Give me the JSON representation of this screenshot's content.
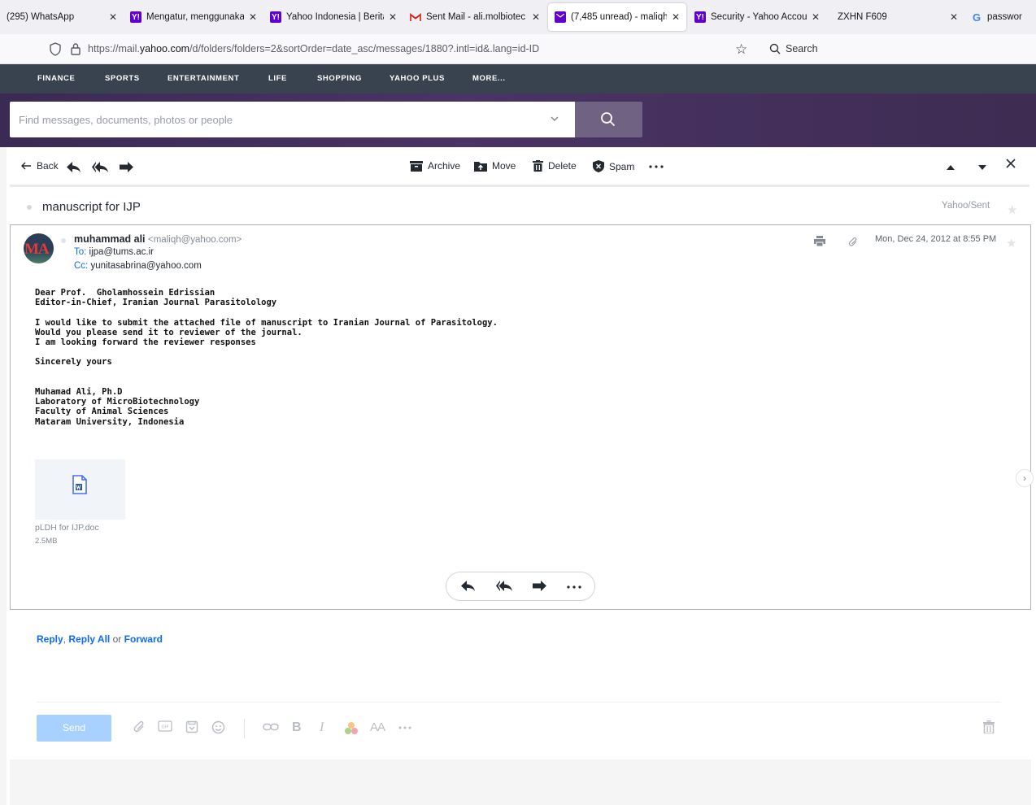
{
  "browser": {
    "tabs": [
      {
        "title": "(295) WhatsApp",
        "favicon": "none"
      },
      {
        "title": "Mengatur, menggunakan",
        "favicon": "yahoo"
      },
      {
        "title": "Yahoo Indonesia | Berita,",
        "favicon": "yahoo"
      },
      {
        "title": "Sent Mail - ali.molbiotec",
        "favicon": "gmail"
      },
      {
        "title": "(7,485 unread) - maliqh@",
        "favicon": "mail",
        "active": true
      },
      {
        "title": "Security - Yahoo Accoun",
        "favicon": "yahoo"
      },
      {
        "title": "ZXHN F609",
        "favicon": "none"
      },
      {
        "title": "passwor",
        "favicon": "google"
      }
    ],
    "url_prefix": "https://mail.",
    "url_domain": "yahoo.com",
    "url_path": "/d/folders/folders=2&sortOrder=date_asc/messages/1880?.intl=id&.lang=id-ID",
    "search_label": "Search"
  },
  "yahoo_nav": [
    "FINANCE",
    "SPORTS",
    "ENTERTAINMENT",
    "LIFE",
    "SHOPPING",
    "YAHOO PLUS",
    "MORE..."
  ],
  "search": {
    "placeholder": "Find messages, documents, photos or people"
  },
  "toolbar": {
    "back": "Back",
    "archive": "Archive",
    "move": "Move",
    "delete": "Delete",
    "spam": "Spam"
  },
  "message": {
    "subject": "manuscript for IJP",
    "folder": "Yahoo/Sent",
    "avatar_initials": "MA",
    "from_name": "muhammad ali",
    "from_email": "<maliqh@yahoo.com>",
    "to_label": "To:",
    "to": "ijpa@tums.ac.ir",
    "cc_label": "Cc:",
    "cc": "yunitasabrina@yahoo.com",
    "date": "Mon, Dec 24, 2012 at 8:55 PM",
    "body": "Dear Prof.  Gholamhossein Edrissian\nEditor-in-Chief, Iranian Journal Parasitolology\n\nI would like to submit the attached file of manuscript to Iranian Journal of Parasitology.\nWould you please send it to reviewer of the journal.\nI am looking forward the reviewer responses\n\nSincerely yours\n\n\nMuhamad Ali, Ph.D\nLaboratory of MicroBiotechnology\nFaculty of Animal Sciences\nMataram University, Indonesia",
    "attachment_name": "pLDH for IJP.doc",
    "attachment_size": "2.5MB"
  },
  "reply": {
    "reply": "Reply",
    "reply_all": "Reply All",
    "or": "or",
    "forward": "Forward",
    "send": "Send"
  },
  "colors": {
    "yahoo_nav": "#39434f",
    "header": "#4a3365",
    "link": "#0f69ff",
    "send_disabled": "#a8d1ff"
  }
}
